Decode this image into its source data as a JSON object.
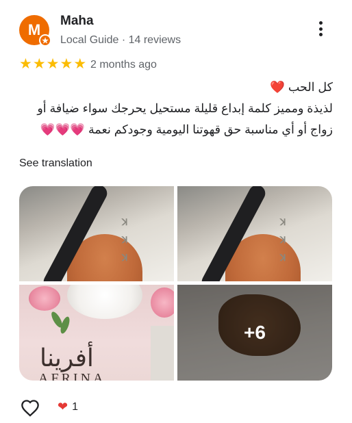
{
  "reviewer": {
    "initial": "M",
    "name": "Maha",
    "meta": "Local Guide · 14 reviews",
    "avatar_color": "#ef6c00"
  },
  "rating": {
    "stars": 5,
    "max": 5,
    "date": "2 months ago",
    "star_color": "#fbbc04"
  },
  "review": {
    "line1": "كل الحب",
    "line1_emoji": "❤️",
    "body": "لذيذة ومميز كلمة إبداع قليلة مستحيل يحرجك سواء ضيافة أو زواج أو أي مناسبة حق قهوتنا اليومية وجودكم نعمة",
    "body_emoji": "💗💗💗"
  },
  "see_translation": "See translation",
  "photos": {
    "brand_arabic": "أفرينا",
    "brand_latin": "AFRINA",
    "more_count": "+6"
  },
  "actions": {
    "like_icon": "heart-outline-icon",
    "reaction_icon": "heart-icon",
    "reaction_count": "1"
  }
}
